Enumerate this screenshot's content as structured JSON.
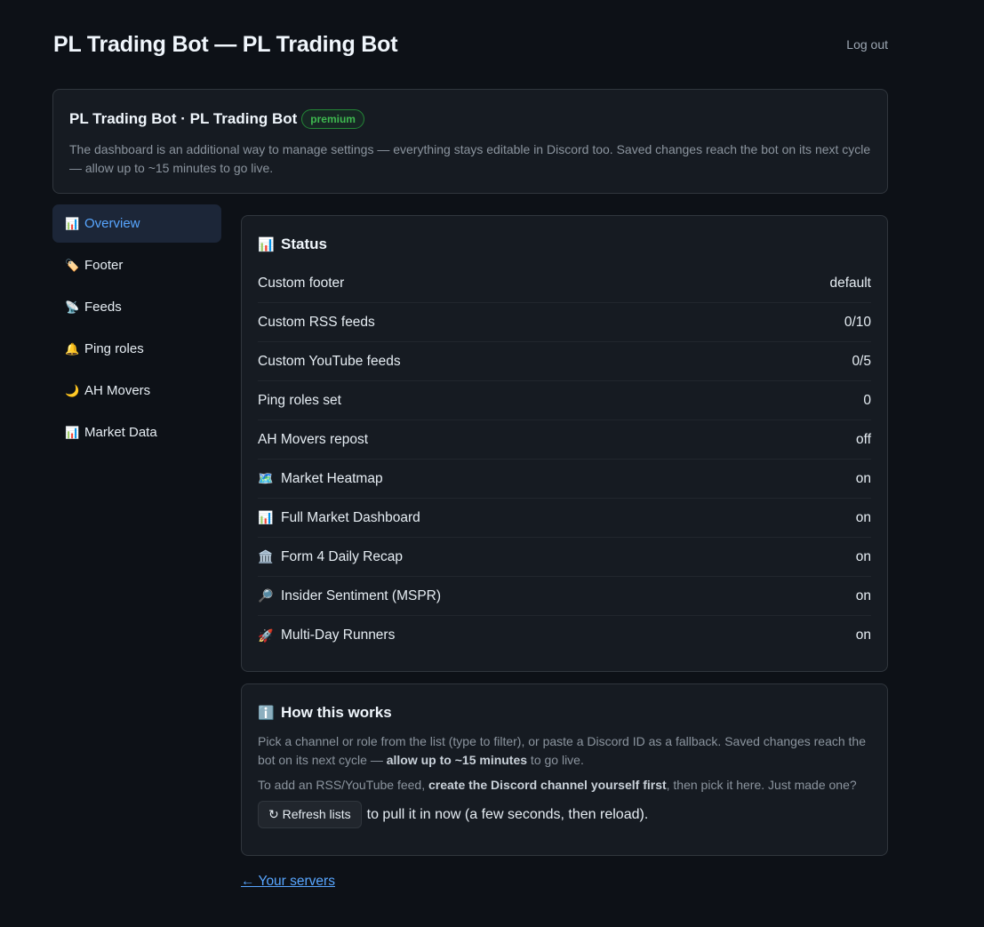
{
  "header": {
    "title": "PL Trading Bot — PL Trading Bot",
    "logout_label": "Log out"
  },
  "guild": {
    "name": "PL Trading Bot · PL Trading Bot",
    "badge": "premium",
    "description": "The dashboard is an additional way to manage settings — everything stays editable in Discord too. Saved changes reach the bot on its next cycle — allow up to ~15 minutes to go live."
  },
  "sidebar": {
    "items": [
      {
        "icon": "📊",
        "label": "Overview"
      },
      {
        "icon": "🏷️",
        "label": "Footer"
      },
      {
        "icon": "📡",
        "label": "Feeds"
      },
      {
        "icon": "🔔",
        "label": "Ping roles"
      },
      {
        "icon": "🌙",
        "label": "AH Movers"
      },
      {
        "icon": "📊",
        "label": "Market Data"
      }
    ]
  },
  "status": {
    "icon": "📊",
    "title": "Status",
    "rows": [
      {
        "icon": "",
        "label": "Custom footer",
        "value": "default"
      },
      {
        "icon": "",
        "label": "Custom RSS feeds",
        "value": "0/10"
      },
      {
        "icon": "",
        "label": "Custom YouTube feeds",
        "value": "0/5"
      },
      {
        "icon": "",
        "label": "Ping roles set",
        "value": "0"
      },
      {
        "icon": "",
        "label": "AH Movers repost",
        "value": "off"
      },
      {
        "icon": "🗺️",
        "label": "Market Heatmap",
        "value": "on"
      },
      {
        "icon": "📊",
        "label": "Full Market Dashboard",
        "value": "on"
      },
      {
        "icon": "🏛️",
        "label": "Form 4 Daily Recap",
        "value": "on"
      },
      {
        "icon": "🔎",
        "label": "Insider Sentiment (MSPR)",
        "value": "on"
      },
      {
        "icon": "🚀",
        "label": "Multi-Day Runners",
        "value": "on"
      }
    ]
  },
  "help": {
    "icon": "ℹ️",
    "title": "How this works",
    "p1_a": "Pick a channel or role from the list (type to filter), or paste a Discord ID as a fallback. Saved changes reach the bot on its next cycle — ",
    "p1_b": "allow up to ~15 minutes",
    "p1_c": " to go live.",
    "p2_a": "To add an RSS/YouTube feed, ",
    "p2_b": "create the Discord channel yourself first",
    "p2_c": ", then pick it here. Just made one?",
    "refresh_label": "↻ Refresh lists",
    "refresh_after": "to pull it in now (a few seconds, then reload)."
  },
  "back_link": "← Your servers"
}
